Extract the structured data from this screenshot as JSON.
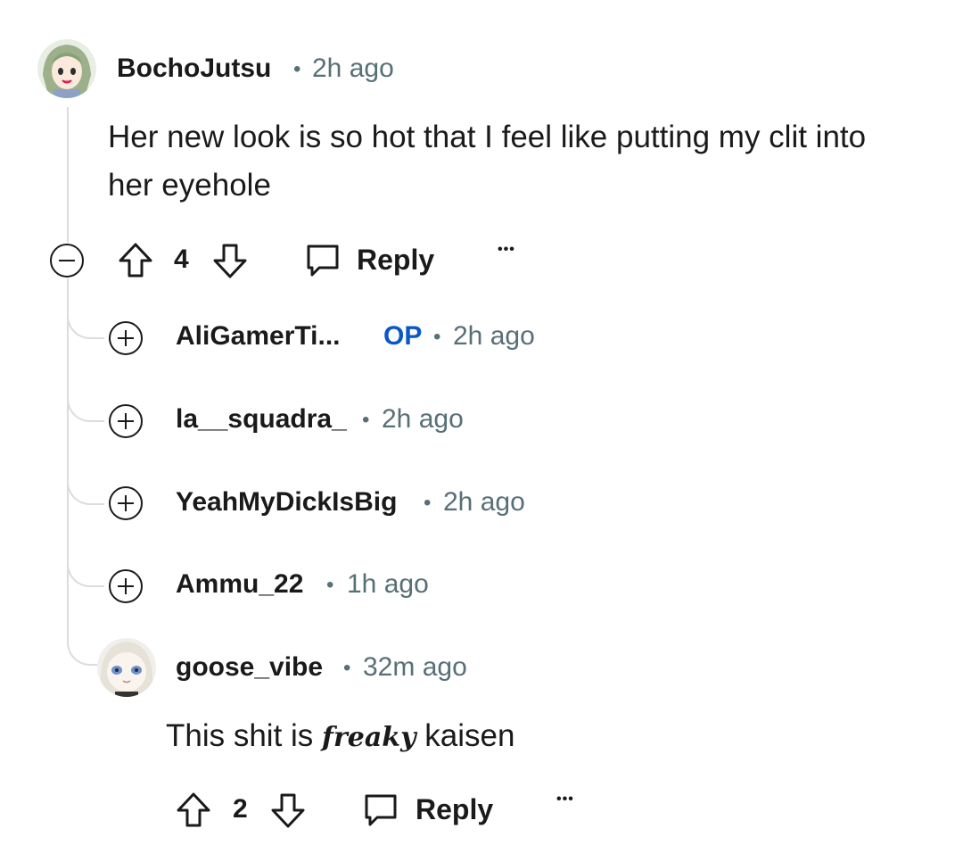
{
  "comment": {
    "username": "BochoJutsu",
    "separator": "•",
    "time": "2h ago",
    "body": "Her new look is so hot that I feel like putting my clit into her eyehole",
    "score": "4",
    "reply_label": "Reply",
    "more_label": "•••",
    "collapse_icon": "minus-circle-icon"
  },
  "collapsed_replies": [
    {
      "username": "AliGamerTi...",
      "op_badge": "OP",
      "separator": "•",
      "time": "2h ago"
    },
    {
      "username": "la__squadra_",
      "separator": "•",
      "time": "2h ago"
    },
    {
      "username": "YeahMyDickIsBig",
      "separator": "•",
      "time": "2h ago"
    },
    {
      "username": "Ammu_22",
      "separator": "•",
      "time": "1h ago"
    }
  ],
  "reply": {
    "username": "goose_vibe",
    "separator": "•",
    "time": "32m ago",
    "body_before": "This shit is",
    "body_styled": "freaky",
    "body_after": "kaisen",
    "score": "2",
    "reply_label": "Reply",
    "more_label": "•••"
  },
  "colors": {
    "text": "#1a1a1b",
    "meta": "#576f76",
    "op": "#0a57c8",
    "thread": "#dadcde"
  }
}
